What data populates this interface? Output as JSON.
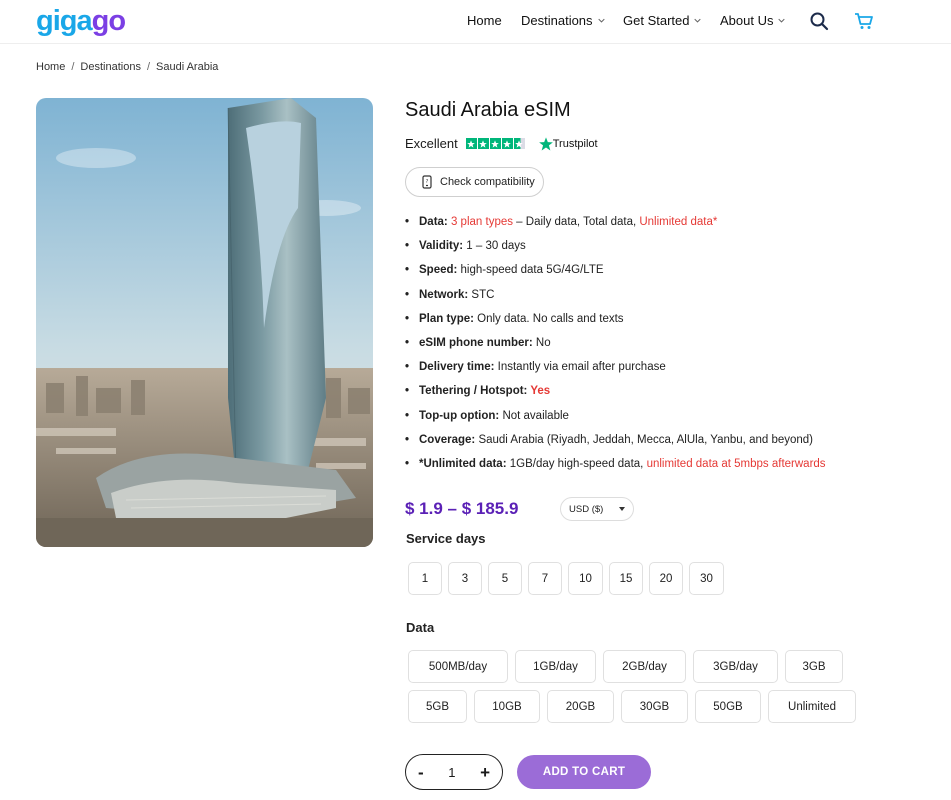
{
  "brand": {
    "logo_part1": "giga",
    "logo_part2": "go"
  },
  "nav": {
    "home": "Home",
    "destinations": "Destinations",
    "get_started": "Get Started",
    "about_us": "About Us"
  },
  "breadcrumb": {
    "home": "Home",
    "destinations": "Destinations",
    "current": "Saudi Arabia",
    "separator": "/"
  },
  "product": {
    "title": "Saudi Arabia eSIM",
    "rating_label": "Excellent",
    "trustpilot": "Trustpilot",
    "check_compatibility": "Check compatibility",
    "rating_stars": 4.5
  },
  "specs": {
    "data_label": "Data:",
    "data_highlight": "3 plan types",
    "data_text": " – Daily data, Total data, ",
    "data_unlimited": "Unlimited data*",
    "validity_label": "Validity:",
    "validity_value": " 1 – 30 days",
    "speed_label": "Speed:",
    "speed_value": " high-speed data 5G/4G/LTE",
    "network_label": "Network:",
    "network_value": " STC",
    "plan_label": "Plan type:",
    "plan_value": " Only data. No calls and texts",
    "phone_label": "eSIM phone number:",
    "phone_value": " No",
    "delivery_label": "Delivery time:",
    "delivery_value": " Instantly via email after purchase",
    "tether_label": "Tethering / Hotspot:",
    "tether_value": " Yes",
    "topup_label": "Top-up option:",
    "topup_value": " Not available",
    "coverage_label": "Coverage:",
    "coverage_value": " Saudi Arabia (Riyadh, Jeddah, Mecca, AlUla, Yanbu, and beyond)",
    "unlimited_label": "*Unlimited data:",
    "unlimited_value": " 1GB/day high-speed data, ",
    "unlimited_red": "unlimited data at 5mbps afterwards"
  },
  "pricing": {
    "range": "$ 1.9 – $ 185.9",
    "currency": "USD ($)"
  },
  "service_days": {
    "label": "Service days",
    "options": [
      "1",
      "3",
      "5",
      "7",
      "10",
      "15",
      "20",
      "30"
    ]
  },
  "data_options": {
    "label": "Data",
    "row1": [
      "500MB/day",
      "1GB/day",
      "2GB/day",
      "3GB/day",
      "3GB"
    ],
    "row2": [
      "5GB",
      "10GB",
      "20GB",
      "30GB",
      "50GB",
      "Unlimited"
    ]
  },
  "cart": {
    "minus": "-",
    "quantity": "1",
    "plus": "+",
    "add_to_cart": "ADD TO CART"
  },
  "colors": {
    "accent_purple": "#5b21b6",
    "button_purple": "#9b6cd7",
    "red": "#e53935",
    "trustpilot_green": "#00b67a",
    "logo_blue": "#1aa7e8",
    "logo_purple": "#7b3fe4"
  }
}
